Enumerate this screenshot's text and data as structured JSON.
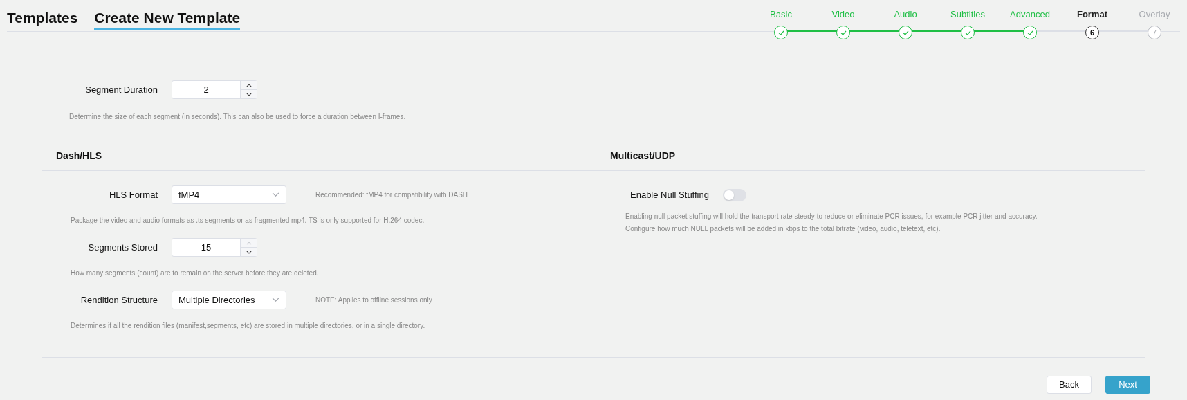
{
  "tabs": [
    {
      "label": "Templates",
      "selected": false
    },
    {
      "label": "Create New Template",
      "selected": true
    }
  ],
  "steps": [
    {
      "label": "Basic",
      "completed": true,
      "selected": false
    },
    {
      "label": "Video",
      "completed": true,
      "selected": false
    },
    {
      "label": "Audio",
      "completed": true,
      "selected": false
    },
    {
      "label": "Subtitles",
      "completed": true,
      "selected": false
    },
    {
      "label": "Advanced",
      "completed": true,
      "selected": false
    },
    {
      "label": "Format",
      "completed": false,
      "selected": true,
      "number": "6"
    },
    {
      "label": "Overlay",
      "completed": false,
      "selected": false,
      "number": "7"
    }
  ],
  "segment_duration": {
    "label": "Segment Duration",
    "value": "2",
    "help": "Determine the size of each segment (in seconds). This can also be used to force a duration between I-frames."
  },
  "dash_hls": {
    "title": "Dash/HLS",
    "fields": [
      {
        "kind": "select",
        "label": "HLS Format",
        "value": "fMP4",
        "note": "Recommended: fMP4 for compatibility with DASH",
        "help": "Package the video and audio formats as .ts segments or as fragmented mp4. TS is only supported for H.264 codec."
      },
      {
        "kind": "number",
        "label": "Segments Stored",
        "value": "15",
        "up_disabled": true,
        "help": "How many segments (count) are to remain on the server before they are deleted."
      },
      {
        "kind": "select",
        "label": "Rendition Structure",
        "value": "Multiple Directories",
        "note": "NOTE: Applies to offline sessions only",
        "help": "Determines if all the rendition files (manifest,segments, etc) are stored in multiple directories, or in a single directory."
      }
    ]
  },
  "multicast_udp": {
    "title": "Multicast/UDP",
    "toggle": {
      "label": "Enable Null Stuffing",
      "on": false
    },
    "help": [
      "Enabling null packet stuffing will hold the transport rate steady to reduce or eliminate PCR issues, for example PCR jitter and accuracy.",
      "Configure how much NULL packets will be added in kbps to the total bitrate (video, audio, teletext, etc)."
    ]
  },
  "buttons": [
    {
      "label": "Back",
      "kind": "secondary"
    },
    {
      "label": "Next",
      "kind": "primary"
    }
  ]
}
